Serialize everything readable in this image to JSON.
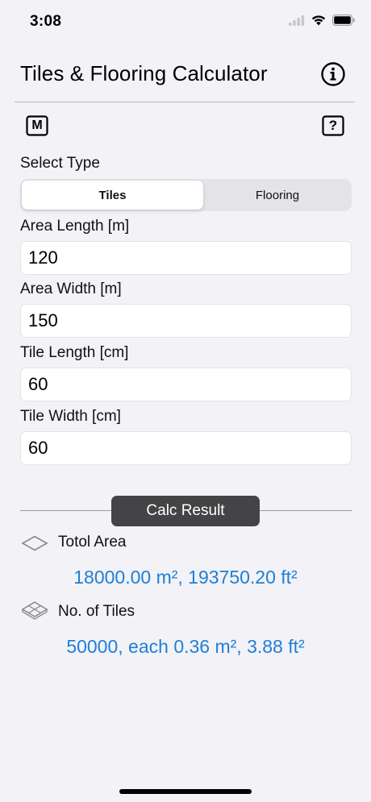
{
  "status_bar": {
    "time": "3:08"
  },
  "nav": {
    "title": "Tiles & Flooring Calculator"
  },
  "buttons": {
    "m_label": "M",
    "q_label": "?"
  },
  "select_type": {
    "label": "Select Type",
    "options": [
      "Tiles",
      "Flooring"
    ],
    "selected": "Tiles"
  },
  "fields": [
    {
      "label": "Area Length [m]",
      "value": "120"
    },
    {
      "label": "Area Width [m]",
      "value": "150"
    },
    {
      "label": "Tile Length [cm]",
      "value": "60"
    },
    {
      "label": "Tile Width [cm]",
      "value": "60"
    }
  ],
  "calc_button": "Calc Result",
  "results": {
    "total_area_label": "Totol Area",
    "total_area_value": "18000.00 m², 193750.20 ft²",
    "tiles_label": "No. of Tiles",
    "tiles_value": "50000, each 0.36 m², 3.88 ft²"
  },
  "colors": {
    "accent": "#1f7fd6",
    "background": "#f2f2f7",
    "button_dark": "#444446"
  }
}
